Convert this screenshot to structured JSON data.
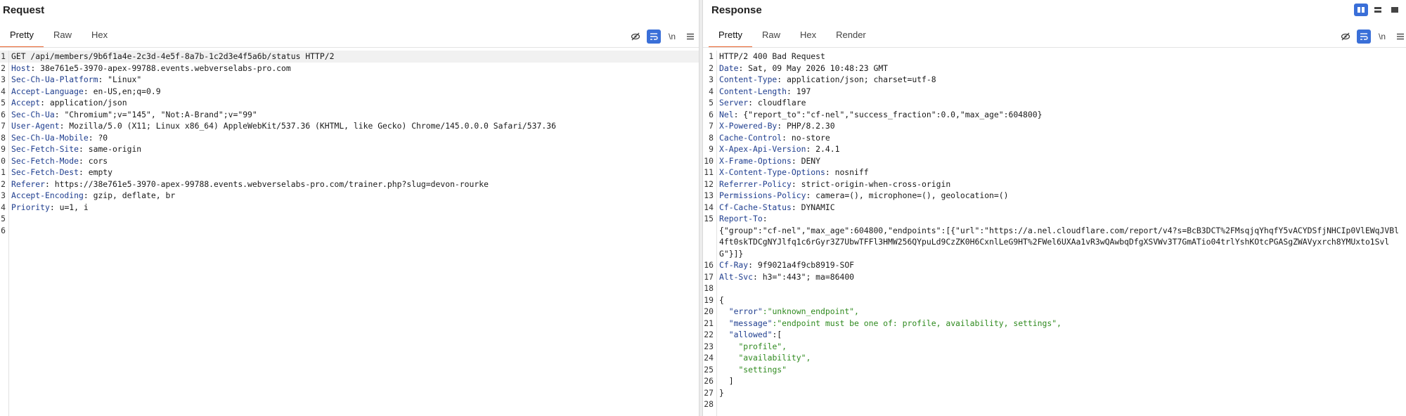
{
  "request": {
    "title": "Request",
    "tabs": [
      "Pretty",
      "Raw",
      "Hex"
    ],
    "active_tab": "Pretty",
    "lines": [
      {
        "n": "1",
        "key": "",
        "value": "GET /api/members/9b6f1a4e-2c3d-4e5f-8a7b-1c2d3e4f5a6b/status HTTP/2"
      },
      {
        "n": "2",
        "key": "Host",
        "value": " 38e761e5-3970-apex-99788.events.webverselabs-pro.com"
      },
      {
        "n": "3",
        "key": "Sec-Ch-Ua-Platform",
        "value": " \"Linux\""
      },
      {
        "n": "4",
        "key": "Accept-Language",
        "value": " en-US,en;q=0.9"
      },
      {
        "n": "5",
        "key": "Accept",
        "value": " application/json"
      },
      {
        "n": "6",
        "key": "Sec-Ch-Ua",
        "value": " \"Chromium\";v=\"145\", \"Not:A-Brand\";v=\"99\""
      },
      {
        "n": "7",
        "key": "User-Agent",
        "value": " Mozilla/5.0 (X11; Linux x86_64) AppleWebKit/537.36 (KHTML, like Gecko) Chrome/145.0.0.0 Safari/537.36"
      },
      {
        "n": "8",
        "key": "Sec-Ch-Ua-Mobile",
        "value": " ?0"
      },
      {
        "n": "9",
        "key": "Sec-Fetch-Site",
        "value": " same-origin"
      },
      {
        "n": "0",
        "key": "Sec-Fetch-Mode",
        "value": " cors"
      },
      {
        "n": "1",
        "key": "Sec-Fetch-Dest",
        "value": " empty"
      },
      {
        "n": "2",
        "key": "Referer",
        "value": " https://38e761e5-3970-apex-99788.events.webverselabs-pro.com/trainer.php?slug=devon-rourke"
      },
      {
        "n": "3",
        "key": "Accept-Encoding",
        "value": " gzip, deflate, br"
      },
      {
        "n": "4",
        "key": "Priority",
        "value": " u=1, i"
      },
      {
        "n": "5",
        "key": "",
        "value": ""
      },
      {
        "n": "6",
        "key": "",
        "value": ""
      }
    ]
  },
  "response": {
    "title": "Response",
    "tabs": [
      "Pretty",
      "Raw",
      "Hex",
      "Render"
    ],
    "active_tab": "Pretty",
    "lines": [
      {
        "n": "1",
        "key": "",
        "value": "HTTP/2 400 Bad Request",
        "str": false
      },
      {
        "n": "2",
        "key": "Date",
        "value": " Sat, 09 May 2026 10:48:23 GMT",
        "str": false
      },
      {
        "n": "3",
        "key": "Content-Type",
        "value": " application/json; charset=utf-8",
        "str": false
      },
      {
        "n": "4",
        "key": "Content-Length",
        "value": " 197",
        "str": false
      },
      {
        "n": "5",
        "key": "Server",
        "value": " cloudflare",
        "str": false
      },
      {
        "n": "6",
        "key": "Nel",
        "value": " {\"report_to\":\"cf-nel\",\"success_fraction\":0.0,\"max_age\":604800}",
        "str": false
      },
      {
        "n": "7",
        "key": "X-Powered-By",
        "value": " PHP/8.2.30",
        "str": false
      },
      {
        "n": "8",
        "key": "Cache-Control",
        "value": " no-store",
        "str": false
      },
      {
        "n": "9",
        "key": "X-Apex-Api-Version",
        "value": " 2.4.1",
        "str": false
      },
      {
        "n": "10",
        "key": "X-Frame-Options",
        "value": " DENY",
        "str": false
      },
      {
        "n": "11",
        "key": "X-Content-Type-Options",
        "value": " nosniff",
        "str": false
      },
      {
        "n": "12",
        "key": "Referrer-Policy",
        "value": " strict-origin-when-cross-origin",
        "str": false
      },
      {
        "n": "13",
        "key": "Permissions-Policy",
        "value": " camera=(), microphone=(), geolocation=()",
        "str": false
      },
      {
        "n": "14",
        "key": "Cf-Cache-Status",
        "value": " DYNAMIC",
        "str": false
      },
      {
        "n": "15",
        "key": "Report-To",
        "value": "\n{\"group\":\"cf-nel\",\"max_age\":604800,\"endpoints\":[{\"url\":\"https://a.nel.cloudflare.com/report/v4?s=BcB3DCT%2FMsqjqYhqfY5vACYDSfjNHCIp0VlEWqJVBl4ft0skTDCgNYJlfq1c6rGyr3Z7UbwTFFl3HMW256QYpuLd9CzZK0H6CxnlLeG9HT%2FWel6UXAa1vR3wQAwbqDfgXSVWv3T7GmATio04trlYshKOtcPGASgZWAVyxrch8YMUxto1SvlG\"}]}",
        "str": false
      },
      {
        "n": "16",
        "key": "Cf-Ray",
        "value": " 9f9021a4f9cb8919-SOF",
        "str": false
      },
      {
        "n": "17",
        "key": "Alt-Svc",
        "value": " h3=\":443\"; ma=86400",
        "str": false
      },
      {
        "n": "18",
        "key": "",
        "value": "",
        "str": false
      },
      {
        "n": "19",
        "key": "",
        "value": "{",
        "str": false
      },
      {
        "n": "20",
        "key": "  \"error\"",
        "value": ":\"unknown_endpoint\",",
        "str": true
      },
      {
        "n": "21",
        "key": "  \"message\"",
        "value": ":\"endpoint must be one of: profile, availability, settings\",",
        "str": true
      },
      {
        "n": "22",
        "key": "  \"allowed\"",
        "value": ":[",
        "str": false
      },
      {
        "n": "23",
        "key": "",
        "value": "    \"profile\",",
        "str": true
      },
      {
        "n": "24",
        "key": "",
        "value": "    \"availability\",",
        "str": true
      },
      {
        "n": "25",
        "key": "",
        "value": "    \"settings\"",
        "str": true
      },
      {
        "n": "26",
        "key": "",
        "value": "  ]",
        "str": false
      },
      {
        "n": "27",
        "key": "",
        "value": "}",
        "str": false
      },
      {
        "n": "28",
        "key": "",
        "value": "",
        "str": false
      }
    ]
  },
  "toolbar": {
    "icons": [
      "hide-icon",
      "wrap-icon",
      "newline-icon",
      "menu-icon"
    ],
    "newline_label": "\\n"
  },
  "layout_icons": [
    "side-by-side-icon",
    "stacked-icon",
    "single-pane-icon"
  ],
  "colors": {
    "accent": "#e8622c",
    "active_blue": "#3a6fd8",
    "key": "#1f3e8f",
    "string": "#2f8a1f"
  }
}
